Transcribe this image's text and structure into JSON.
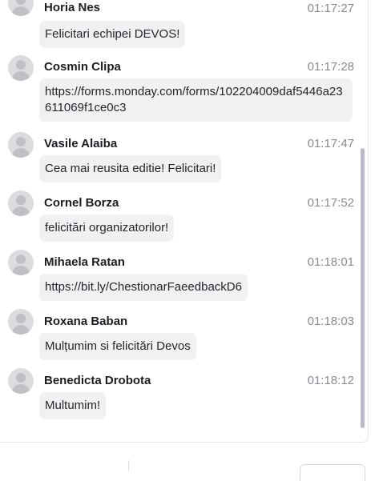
{
  "messages": [
    {
      "author": "Horia Nes",
      "time": "01:17:27",
      "text": "Felicitari echipei DEVOS!"
    },
    {
      "author": "Cosmin Clipa",
      "time": "01:17:28",
      "text": "https://forms.monday.com/forms/102204009daf5446a23611069f1ce0c3"
    },
    {
      "author": "Vasile Alaiba",
      "time": "01:17:47",
      "text": "Cea mai reusita editie! Felicitari!"
    },
    {
      "author": "Cornel Borza",
      "time": "01:17:52",
      "text": "felicitări organizatorilor!"
    },
    {
      "author": "Mihaela Ratan",
      "time": "01:18:01",
      "text": "https://bit.ly/ChestionarFaeedbackD6"
    },
    {
      "author": "Roxana Baban",
      "time": "01:18:03",
      "text": "Mulțumim si felicitări Devos"
    },
    {
      "author": "Benedicta Drobota",
      "time": "01:18:12",
      "text": "Multumim!"
    }
  ]
}
